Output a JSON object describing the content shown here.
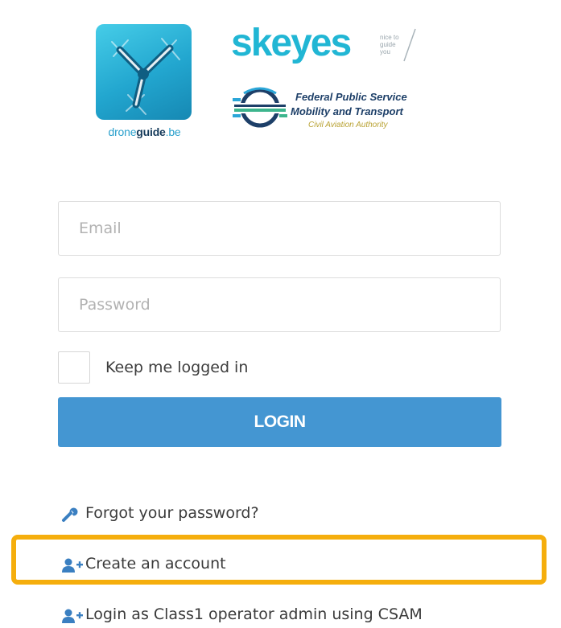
{
  "header": {
    "droneguide_logo": {
      "text_part1": "drone",
      "text_part2": "guide",
      "text_part3": ".be",
      "color": "#2aa0cc"
    },
    "skeyes_logo": {
      "word": "skeyes",
      "tagline_line1": "nice to",
      "tagline_line2": "guide",
      "tagline_line3": "you",
      "color": "#21b6d4"
    },
    "fps_logo": {
      "line1": "Federal Public Service",
      "line2": "Mobility and Transport",
      "line3": "Civil Aviation Authority",
      "color": "#1d3f68"
    }
  },
  "form": {
    "email_placeholder": "Email",
    "password_placeholder": "Password",
    "remember_label": "Keep me logged in",
    "remember_checked": false,
    "login_label": "LOGIN",
    "login_color": "#4496d2"
  },
  "links": {
    "forgot": {
      "label": "Forgot your password?",
      "icon": "wrench-icon"
    },
    "create": {
      "label": "Create an account",
      "icon": "add-user-icon"
    },
    "csam": {
      "label": "Login as Class1 operator admin using CSAM",
      "icon": "add-user-icon"
    }
  },
  "highlight_color": "#f5ae0d"
}
